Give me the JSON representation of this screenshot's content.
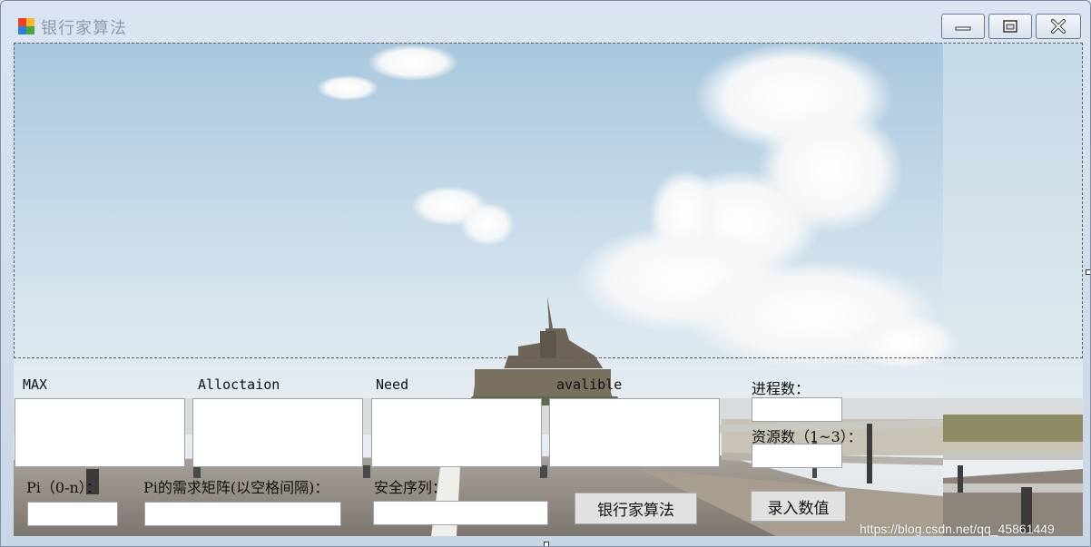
{
  "window": {
    "title": "银行家算法",
    "icon": "winforms-app-icon"
  },
  "title_buttons": {
    "minimize_icon": "minimize-icon",
    "maximize_icon": "maximize-icon",
    "close_icon": "close-icon"
  },
  "matrix_labels": {
    "max": "MAX",
    "allocation": "Alloctaion",
    "need": "Need",
    "available": "avalible"
  },
  "settings": {
    "process_count_label": "进程数：",
    "resource_count_label": "资源数（1~3）："
  },
  "request": {
    "pi_label": "Pi（0-n）：",
    "pi_request_label": "Pi的需求矩阵(以空格间隔)：",
    "safe_sequence_label": "安全序列："
  },
  "buttons": {
    "bankers_algorithm": "银行家算法",
    "enter_values": "录入数值"
  },
  "fields": {
    "max": "",
    "allocation": "",
    "need": "",
    "available": "",
    "process_count": "",
    "resource_count": "",
    "pi": "",
    "pi_request": "",
    "safe_sequence": ""
  },
  "watermark": "https://blog.csdn.net/qq_45861449",
  "colors": {
    "sky_top": "#a9c7de",
    "sky_bottom": "#e8f0f5",
    "button_face": "#e1e1e1"
  }
}
